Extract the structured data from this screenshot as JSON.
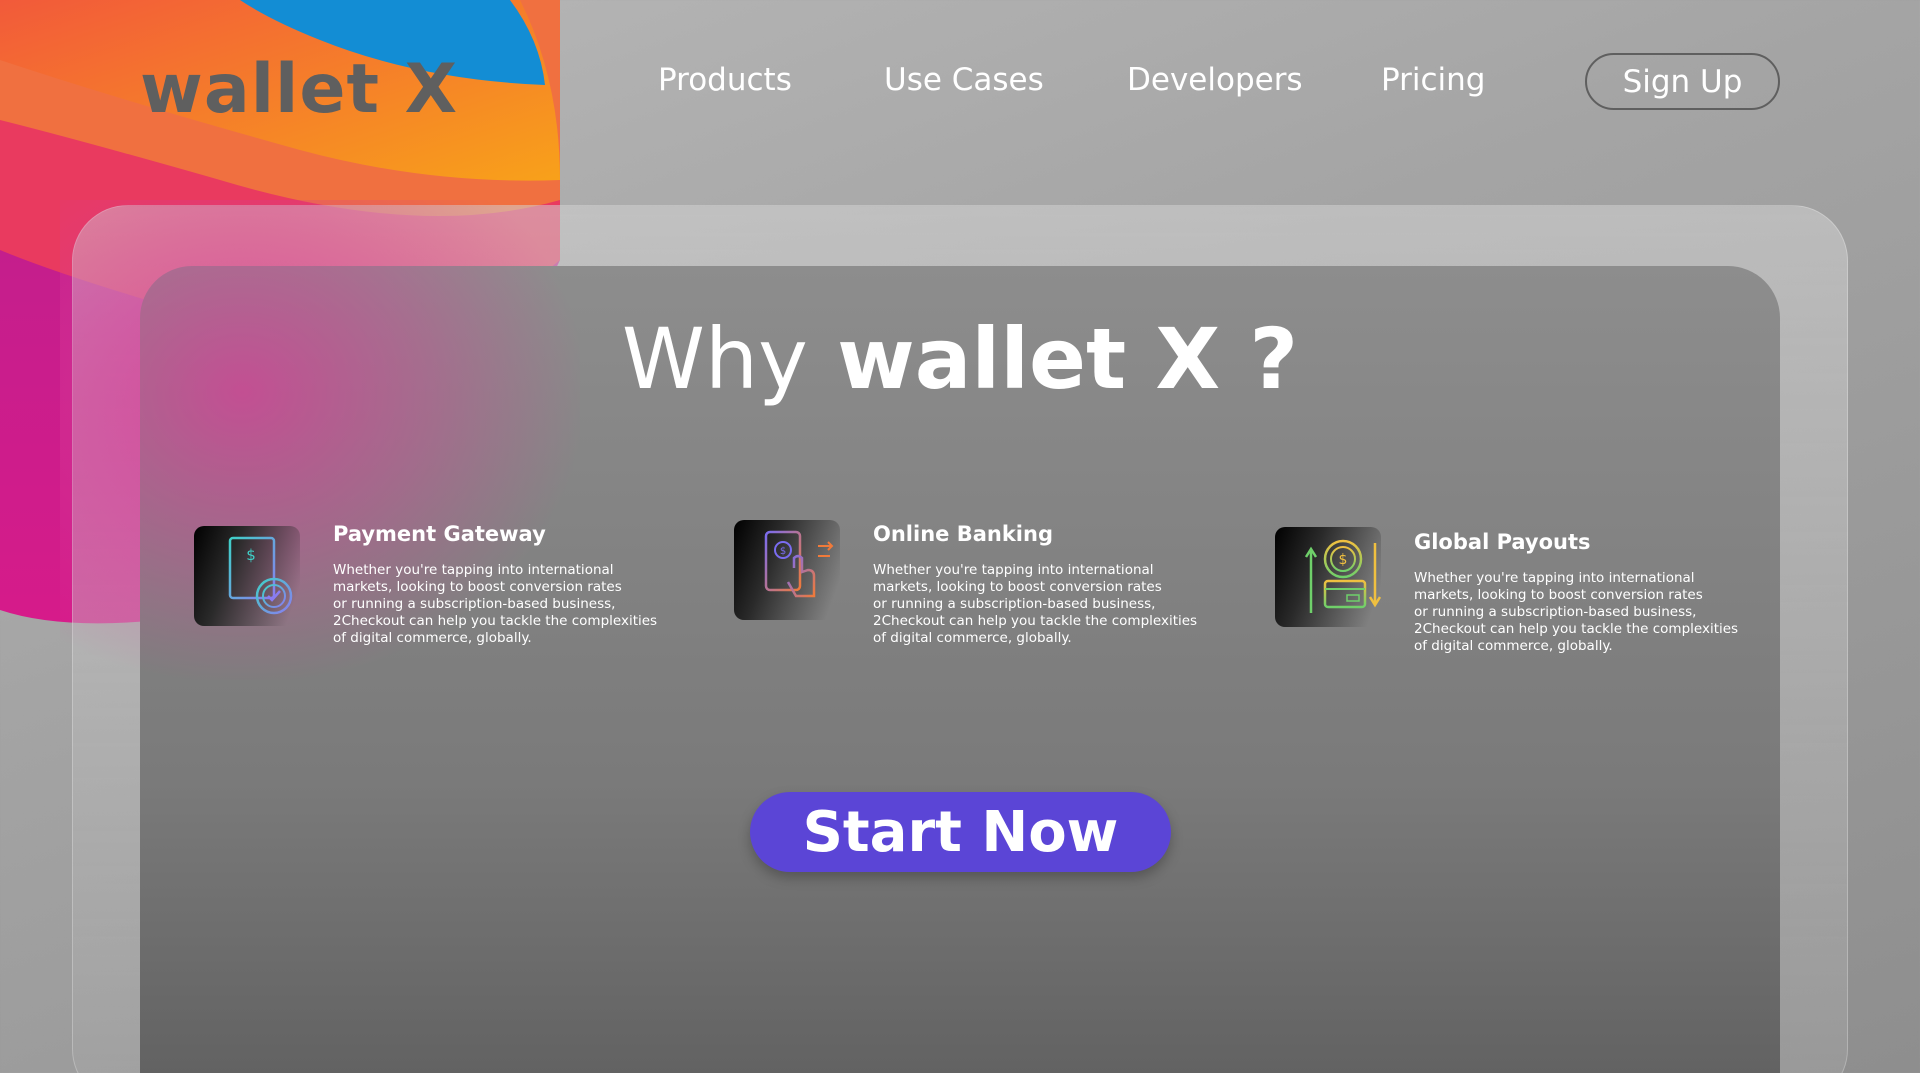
{
  "brand": {
    "logo_text": "wallet X"
  },
  "nav": {
    "items": [
      "Products",
      "Use Cases",
      "Developers",
      "Pricing"
    ],
    "signup_label": "Sign Up"
  },
  "hero": {
    "heading_light": "Why",
    "heading_bold": "wallet X ?"
  },
  "features": [
    {
      "title": "Payment Gateway",
      "icon": "invoice-check-icon",
      "description": "Whether you're tapping into international\nmarkets, looking to boost conversion rates\nor running a subscription-based business,\n2Checkout can help you tackle the complexities\nof digital commerce, globally."
    },
    {
      "title": "Online Banking",
      "icon": "mobile-banking-hand-icon",
      "description": "Whether you're tapping into international\nmarkets, looking to boost conversion rates\nor running a subscription-based business,\n2Checkout can help you tackle the complexities\nof digital commerce, globally."
    },
    {
      "title": "Global Payouts",
      "icon": "coin-card-transfer-icon",
      "description": "Whether you're tapping into international\nmarkets, looking to boost conversion rates\nor running a subscription-based business,\n2Checkout can help you tackle the complexities\nof digital commerce, globally."
    }
  ],
  "cta": {
    "label": "Start Now"
  },
  "colors": {
    "accent_button": "#5b45d6",
    "logo_text": "#5f5f5f",
    "wave_orange": "#f7a01c",
    "wave_blue": "#138dd4",
    "wave_pink": "#e8317a",
    "wave_magenta": "#c8128e"
  }
}
